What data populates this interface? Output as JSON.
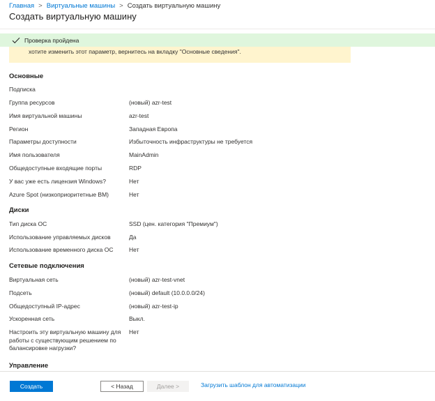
{
  "breadcrumb": {
    "items": [
      "Главная",
      "Виртуальные машины",
      "Создать виртуальную машину"
    ],
    "separator": ">"
  },
  "page": {
    "title": "Создать виртуальную машину"
  },
  "validation": {
    "text": "Проверка пройдена",
    "icon": "checkmark-icon",
    "color": "#dff6dd"
  },
  "info_box": {
    "text": "хотите изменить этот параметр, вернитесь на вкладку \"Основные сведения\"."
  },
  "sections": {
    "basics": {
      "heading": "Основные",
      "rows": [
        {
          "label": "Подписка",
          "value": ""
        },
        {
          "label": "Группа ресурсов",
          "value": "(новый) azr-test"
        },
        {
          "label": "Имя виртуальной машины",
          "value": "azr-test"
        },
        {
          "label": "Регион",
          "value": "Западная Европа"
        },
        {
          "label": "Параметры доступности",
          "value": "Избыточность инфраструктуры не требуется"
        },
        {
          "label": "Имя пользователя",
          "value": "MainAdmin"
        },
        {
          "label": "Общедоступные входящие порты",
          "value": "RDP"
        },
        {
          "label": "У вас уже есть лицензия Windows?",
          "value": "Нет"
        },
        {
          "label": "Azure Spot (низкоприоритетные ВМ)",
          "value": "Нет"
        }
      ]
    },
    "disks": {
      "heading": "Диски",
      "rows": [
        {
          "label": "Тип диска ОС",
          "value": "SSD (цен. категория \"Премиум\")"
        },
        {
          "label": "Использование управляемых дисков",
          "value": "Да"
        },
        {
          "label": "Использование временного диска ОС",
          "value": "Нет"
        }
      ]
    },
    "network": {
      "heading": "Сетевые подключения",
      "rows": [
        {
          "label": "Виртуальная сеть",
          "value": "(новый) azr-test-vnet"
        },
        {
          "label": "Подсеть",
          "value": "(новый) default (10.0.0.0/24)"
        },
        {
          "label": "Общедоступный IP-адрес",
          "value": "(новый) azr-test-ip"
        },
        {
          "label": "Ускоренная сеть",
          "value": "Выкл."
        },
        {
          "label": "Настроить эту виртуальную машину для работы с существующим решением по балансировке нагрузки?",
          "value": "Нет"
        }
      ]
    },
    "management": {
      "heading": "Управление"
    }
  },
  "footer": {
    "create_label": "Создать",
    "back_label": "< Назад",
    "next_label": "Далее >",
    "template_link": "Загрузить шаблон для автоматизации"
  },
  "colors": {
    "accent": "#0078d4",
    "banner_success": "#dff6dd",
    "info_warning": "#fff4ce",
    "check": "#107c10"
  }
}
